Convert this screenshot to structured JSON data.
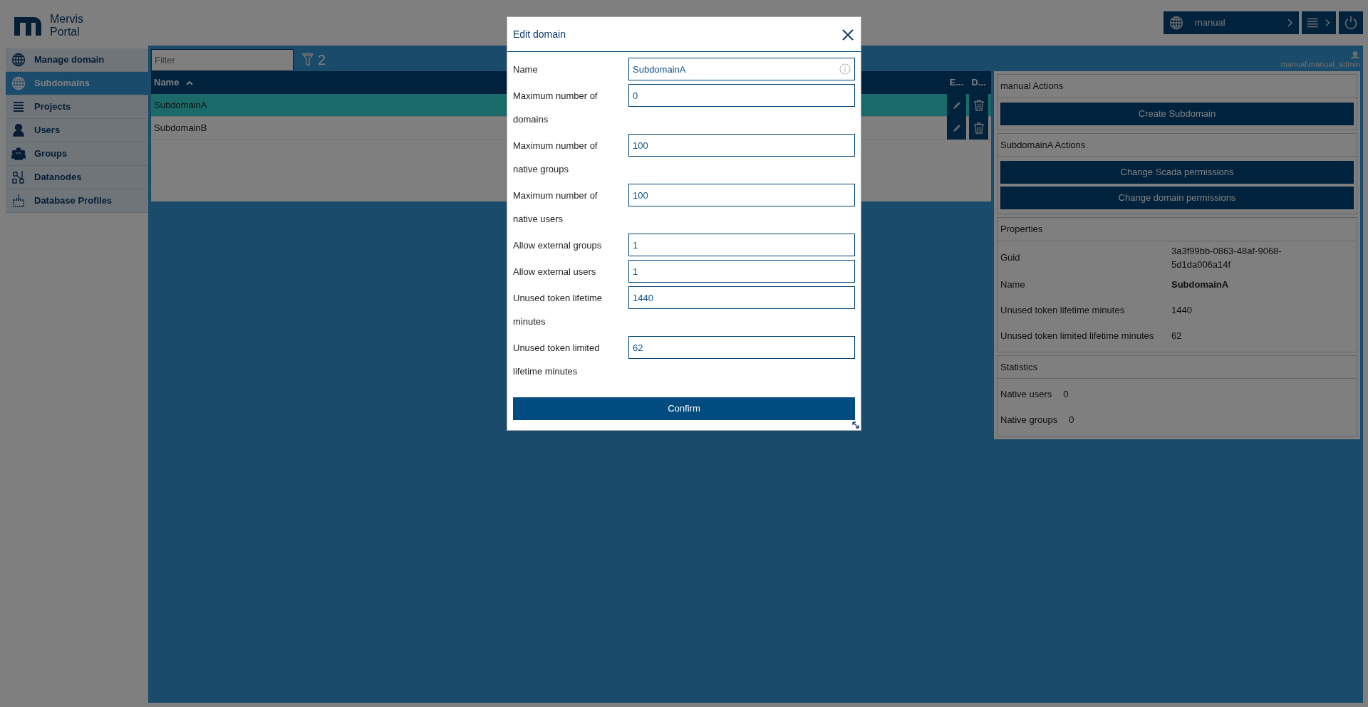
{
  "header": {
    "logo_lines": [
      "Mervis",
      "Portal"
    ],
    "domain_button": "manual",
    "user": "manual\\manual_admin"
  },
  "sidebar": {
    "items": [
      {
        "label": "Manage domain",
        "selected": false
      },
      {
        "label": "Subdomains",
        "selected": true
      },
      {
        "label": "Projects",
        "selected": false
      },
      {
        "label": "Users",
        "selected": false
      },
      {
        "label": "Groups",
        "selected": false
      },
      {
        "label": "Datanodes",
        "selected": false
      },
      {
        "label": "Database Profiles",
        "selected": false
      }
    ]
  },
  "filter": {
    "placeholder": "Filter",
    "count": "2"
  },
  "table": {
    "columns": [
      {
        "label": "Name",
        "sorted": true
      },
      {
        "label": "E...",
        "sorted": false
      },
      {
        "label": "D...",
        "sorted": false
      }
    ],
    "rows": [
      {
        "name": "SubdomainA",
        "selected": true
      },
      {
        "name": "SubdomainB",
        "selected": false
      }
    ]
  },
  "actions": [
    {
      "title": "manual Actions",
      "buttons": [
        "Create Subdomain"
      ]
    },
    {
      "title": "SubdomainA Actions",
      "buttons": [
        "Change Scada permissions",
        "Change domain permissions"
      ]
    }
  ],
  "properties": {
    "title": "Properties",
    "rows": [
      {
        "label": "Guid",
        "value": "3a3f99bb-0863-48af-9068-5d1da006a14f",
        "bold": false
      },
      {
        "label": "Name",
        "value": "SubdomainA",
        "bold": true
      },
      {
        "label": "Unused token lifetime minutes",
        "value": "1440",
        "bold": false
      },
      {
        "label": "Unused token limited lifetime minutes",
        "value": "62",
        "bold": false
      }
    ]
  },
  "statistics": {
    "title": "Statistics",
    "rows": [
      {
        "label": "Native users",
        "value": "0"
      },
      {
        "label": "Native groups",
        "value": "0"
      }
    ]
  },
  "modal": {
    "title": "Edit domain",
    "fields": [
      {
        "label": "Name",
        "value": "SubdomainA",
        "info": true
      },
      {
        "label": "Maximum number of domains",
        "value": "0",
        "info": false
      },
      {
        "label": "Maximum number of native groups",
        "value": "100",
        "info": false
      },
      {
        "label": "Maximum number of native users",
        "value": "100",
        "info": false
      },
      {
        "label": "Allow external groups",
        "value": "1",
        "info": false
      },
      {
        "label": "Allow external users",
        "value": "1",
        "info": false
      },
      {
        "label": "Unused token lifetime minutes",
        "value": "1440",
        "info": false
      },
      {
        "label": "Unused token limited lifetime minutes",
        "value": "62",
        "info": false
      }
    ],
    "confirm": "Confirm"
  }
}
